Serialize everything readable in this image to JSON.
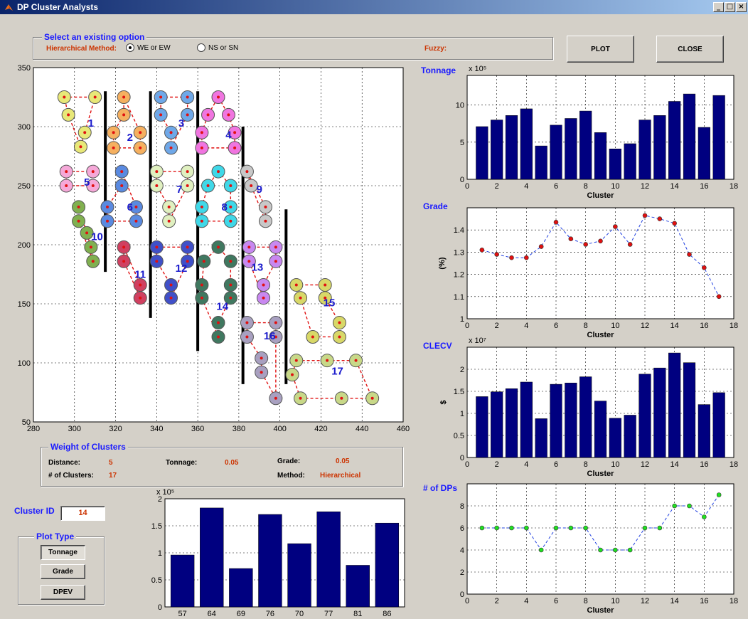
{
  "window": {
    "title": "DP Cluster Analysts",
    "min": "_",
    "max": "□",
    "close": "×"
  },
  "options": {
    "group_title": "Select an existing option",
    "hier_label": "Hierarchical Method:",
    "radio1": "WE or EW",
    "radio2": "NS or SN",
    "fuzzy_label": "Fuzzy:",
    "radio1_selected": true
  },
  "buttons": {
    "plot": "PLOT",
    "close": "CLOSE"
  },
  "weights": {
    "group_title": "Weight of Clusters",
    "distance_label": "Distance:",
    "distance_value": "5",
    "tonnage_label": "Tonnage:",
    "tonnage_value": "0.05",
    "grade_label": "Grade:",
    "grade_value": "0.05",
    "nclusters_label": "# of Clusters:",
    "nclusters_value": "17",
    "method_label": "Method:",
    "method_value": "Hierarchical"
  },
  "cluster_id": {
    "label": "Cluster ID",
    "value": "14"
  },
  "plot_type": {
    "group_title": "Plot Type",
    "tonnage": "Tonnage",
    "grade": "Grade",
    "dpev": "DPEV"
  },
  "icons": {
    "app": "matlab-icon"
  },
  "chart_data": [
    {
      "type": "scatter",
      "name": "cluster-map",
      "xlim": [
        280,
        460
      ],
      "ylim": [
        50,
        350
      ],
      "xticks": [
        280,
        300,
        320,
        340,
        360,
        380,
        400,
        420,
        440,
        460
      ],
      "yticks": [
        50,
        100,
        150,
        200,
        250,
        300,
        350
      ],
      "grid": true,
      "clusters": [
        {
          "id": "1",
          "color": "#e8e878",
          "label": [
            308,
            300
          ],
          "points": [
            [
              295,
              325
            ],
            [
              310,
              325
            ],
            [
              297,
              310
            ],
            [
              305,
              295
            ],
            [
              303,
              283
            ]
          ]
        },
        {
          "id": "2",
          "color": "#f5b060",
          "label": [
            327,
            288
          ],
          "points": [
            [
              324,
              325
            ],
            [
              324,
              310
            ],
            [
              319,
              295
            ],
            [
              332,
              295
            ],
            [
              319,
              282
            ],
            [
              332,
              282
            ]
          ]
        },
        {
          "id": "3",
          "color": "#6fa8e8",
          "label": [
            352,
            300
          ],
          "points": [
            [
              342,
              325
            ],
            [
              355,
              325
            ],
            [
              342,
              310
            ],
            [
              355,
              310
            ],
            [
              347,
              295
            ],
            [
              347,
              282
            ]
          ]
        },
        {
          "id": "4",
          "color": "#f075e0",
          "label": [
            375,
            290
          ],
          "points": [
            [
              370,
              325
            ],
            [
              365,
              310
            ],
            [
              375,
              310
            ],
            [
              362,
              295
            ],
            [
              378,
              295
            ],
            [
              362,
              282
            ],
            [
              378,
              282
            ]
          ]
        },
        {
          "id": "5",
          "color": "#f5a8d8",
          "label": [
            306,
            250
          ],
          "points": [
            [
              296,
              262
            ],
            [
              309,
              262
            ],
            [
              296,
              250
            ],
            [
              309,
              250
            ]
          ]
        },
        {
          "id": "6",
          "color": "#5a8ae0",
          "label": [
            327,
            229
          ],
          "points": [
            [
              323,
              262
            ],
            [
              323,
              250
            ],
            [
              316,
              232
            ],
            [
              330,
              232
            ],
            [
              316,
              220
            ],
            [
              330,
              220
            ]
          ]
        },
        {
          "id": "7",
          "color": "#e0f0c0",
          "label": [
            351,
            244
          ],
          "points": [
            [
              340,
              262
            ],
            [
              355,
              262
            ],
            [
              340,
              250
            ],
            [
              355,
              250
            ],
            [
              346,
              232
            ],
            [
              346,
              220
            ]
          ]
        },
        {
          "id": "8",
          "color": "#40d8e8",
          "label": [
            373,
            229
          ],
          "points": [
            [
              370,
              262
            ],
            [
              365,
              250
            ],
            [
              376,
              250
            ],
            [
              362,
              232
            ],
            [
              376,
              232
            ],
            [
              362,
              220
            ],
            [
              376,
              220
            ]
          ]
        },
        {
          "id": "9",
          "color": "#c8c8c8",
          "label": [
            390,
            244
          ],
          "points": [
            [
              384,
              262
            ],
            [
              386,
              250
            ],
            [
              393,
              232
            ],
            [
              393,
              220
            ]
          ]
        },
        {
          "id": "10",
          "color": "#80b050",
          "label": [
            311,
            204
          ],
          "points": [
            [
              302,
              232
            ],
            [
              302,
              220
            ],
            [
              306,
              210
            ],
            [
              308,
              198
            ],
            [
              309,
              186
            ]
          ]
        },
        {
          "id": "11",
          "color": "#d04060",
          "label": [
            332,
            172
          ],
          "points": [
            [
              324,
              198
            ],
            [
              324,
              186
            ],
            [
              332,
              166
            ],
            [
              332,
              155
            ]
          ]
        },
        {
          "id": "12",
          "color": "#4050c8",
          "label": [
            352,
            177
          ],
          "points": [
            [
              340,
              198
            ],
            [
              355,
              198
            ],
            [
              340,
              186
            ],
            [
              355,
              186
            ],
            [
              347,
              166
            ],
            [
              347,
              155
            ]
          ]
        },
        {
          "id": "13",
          "color": "#c888f0",
          "label": [
            389,
            178
          ],
          "points": [
            [
              385,
              198
            ],
            [
              398,
              198
            ],
            [
              385,
              186
            ],
            [
              398,
              186
            ],
            [
              392,
              166
            ],
            [
              392,
              155
            ]
          ]
        },
        {
          "id": "14",
          "color": "#407860",
          "label": [
            372,
            145
          ],
          "points": [
            [
              370,
              198
            ],
            [
              363,
              186
            ],
            [
              376,
              186
            ],
            [
              362,
              166
            ],
            [
              376,
              166
            ],
            [
              362,
              155
            ],
            [
              376,
              155
            ],
            [
              370,
              134
            ],
            [
              370,
              122
            ]
          ]
        },
        {
          "id": "15",
          "color": "#d8d868",
          "label": [
            424,
            148
          ],
          "points": [
            [
              408,
              166
            ],
            [
              422,
              166
            ],
            [
              410,
              155
            ],
            [
              422,
              155
            ],
            [
              429,
              134
            ],
            [
              416,
              122
            ],
            [
              429,
              122
            ]
          ]
        },
        {
          "id": "16",
          "color": "#a8a0c0",
          "label": [
            395,
            120
          ],
          "points": [
            [
              384,
              134
            ],
            [
              398,
              134
            ],
            [
              384,
              122
            ],
            [
              398,
              122
            ],
            [
              391,
              104
            ],
            [
              391,
              92
            ],
            [
              398,
              70
            ]
          ]
        },
        {
          "id": "17",
          "color": "#c8d888",
          "label": [
            428,
            90
          ],
          "points": [
            [
              408,
              102
            ],
            [
              423,
              102
            ],
            [
              437,
              102
            ],
            [
              406,
              90
            ],
            [
              410,
              70
            ],
            [
              430,
              70
            ],
            [
              445,
              70
            ]
          ]
        }
      ],
      "separators": [
        [
          315,
          330,
          177
        ],
        [
          337,
          330,
          138
        ],
        [
          360,
          330,
          110
        ],
        [
          382,
          300,
          82
        ],
        [
          403,
          230,
          82
        ]
      ]
    },
    {
      "type": "bar",
      "name": "tonnage-chart",
      "title": "Tonnage",
      "exp": "x 10⁵",
      "x": [
        1,
        2,
        3,
        4,
        5,
        6,
        7,
        8,
        9,
        10,
        11,
        12,
        13,
        14,
        15,
        16,
        17
      ],
      "values": [
        7.1,
        8.0,
        8.6,
        9.5,
        4.5,
        7.3,
        8.2,
        9.2,
        6.3,
        4.1,
        4.8,
        8.0,
        8.6,
        10.5,
        11.5,
        7.0,
        11.3
      ],
      "xlim": [
        0,
        18
      ],
      "ylim": [
        0,
        14
      ],
      "xticks": [
        0,
        2,
        4,
        6,
        8,
        10,
        12,
        14,
        16,
        18
      ],
      "yticks": [
        0,
        5,
        10
      ],
      "xlabel": "Cluster",
      "ylabel": ""
    },
    {
      "type": "line",
      "name": "grade-chart",
      "title": "Grade",
      "x": [
        1,
        2,
        3,
        4,
        5,
        6,
        7,
        8,
        9,
        10,
        11,
        12,
        13,
        14,
        15,
        16,
        17
      ],
      "values": [
        1.31,
        1.29,
        1.275,
        1.275,
        1.325,
        1.435,
        1.36,
        1.335,
        1.35,
        1.415,
        1.335,
        1.465,
        1.45,
        1.43,
        1.29,
        1.23,
        1.1
      ],
      "xlim": [
        0,
        18
      ],
      "ylim": [
        1,
        1.5
      ],
      "xticks": [
        0,
        2,
        4,
        6,
        8,
        10,
        12,
        14,
        16,
        18
      ],
      "yticks": [
        1,
        1.1,
        1.2,
        1.3,
        1.4
      ],
      "xlabel": "Cluster",
      "ylabel": "(%)",
      "marker_color": "#e01010"
    },
    {
      "type": "bar",
      "name": "clecv-chart",
      "title": "CLECV",
      "exp": "x 10⁷",
      "x": [
        1,
        2,
        3,
        4,
        5,
        6,
        7,
        8,
        9,
        10,
        11,
        12,
        13,
        14,
        15,
        16,
        17
      ],
      "values": [
        1.38,
        1.49,
        1.56,
        1.71,
        0.88,
        1.66,
        1.69,
        1.83,
        1.28,
        0.89,
        0.96,
        1.89,
        2.03,
        2.37,
        2.15,
        1.2,
        1.47
      ],
      "xlim": [
        0,
        18
      ],
      "ylim": [
        0,
        2.5
      ],
      "xticks": [
        0,
        2,
        4,
        6,
        8,
        10,
        12,
        14,
        16,
        18
      ],
      "yticks": [
        0,
        0.5,
        1,
        1.5,
        2
      ],
      "xlabel": "Cluster",
      "ylabel": "$"
    },
    {
      "type": "line",
      "name": "dps-chart",
      "title": "# of DPs",
      "x": [
        1,
        2,
        3,
        4,
        5,
        6,
        7,
        8,
        9,
        10,
        11,
        12,
        13,
        14,
        15,
        16,
        17
      ],
      "values": [
        6,
        6,
        6,
        6,
        4,
        6,
        6,
        6,
        4,
        4,
        4,
        6,
        6,
        8,
        8,
        7,
        9
      ],
      "xlim": [
        0,
        18
      ],
      "ylim": [
        0,
        10
      ],
      "xticks": [
        0,
        2,
        4,
        6,
        8,
        10,
        12,
        14,
        16,
        18
      ],
      "yticks": [
        0,
        2,
        4,
        6,
        8
      ],
      "xlabel": "Cluster",
      "ylabel": "",
      "marker_color": "#20e020"
    },
    {
      "type": "bar",
      "name": "cluster-dp-chart",
      "exp": "x 10⁵",
      "categories": [
        "57",
        "64",
        "69",
        "76",
        "70",
        "77",
        "81",
        "86"
      ],
      "values": [
        0.96,
        1.83,
        0.71,
        1.71,
        1.17,
        1.76,
        0.77,
        1.55
      ],
      "ylim": [
        0,
        2
      ],
      "yticks": [
        0,
        0.5,
        1,
        1.5,
        2
      ]
    }
  ]
}
